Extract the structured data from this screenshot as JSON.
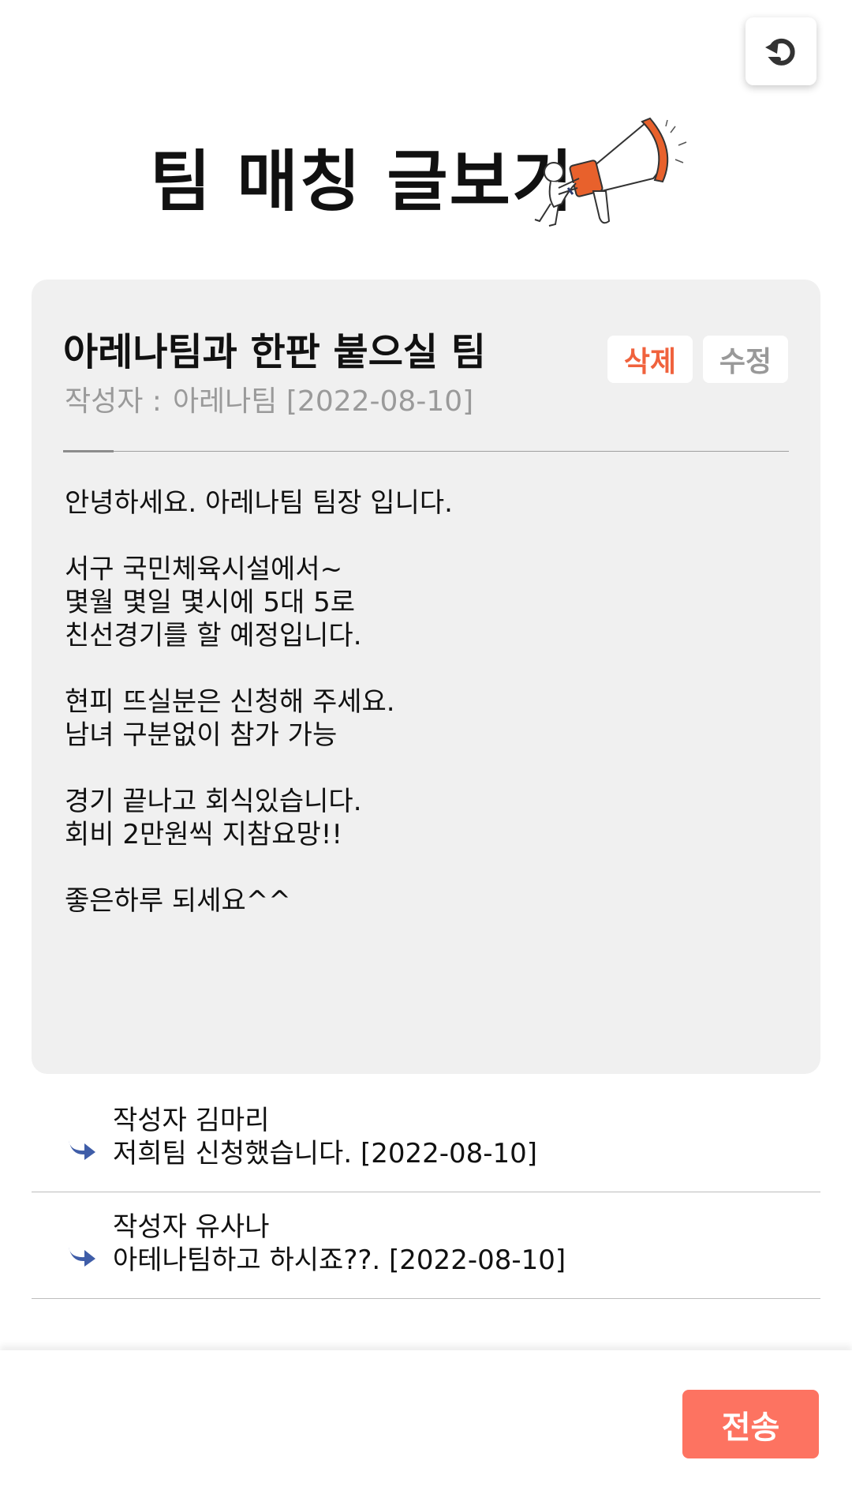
{
  "header": {
    "title": "팀 매칭 글보기",
    "back_icon": "undo-arrow-icon",
    "illustration": "megaphone-icon"
  },
  "post": {
    "title": "아레나팀과 한판 붙으실 팀",
    "author_label": "작성자 :",
    "author_name": "아레나팀",
    "date": "[2022-08-10]",
    "delete_label": "삭제",
    "edit_label": "수정",
    "body_lines": [
      "안녕하세요. 아레나팀 팀장 입니다.",
      "",
      "서구 국민체육시설에서~",
      "몇월 몇일 몇시에 5대 5로",
      "친선경기를 할 예정입니다.",
      "",
      "현피 뜨실분은 신청해 주세요.",
      "남녀 구분없이 참가 가능",
      "",
      "경기 끝나고 회식있습니다.",
      "회비 2만원씩 지참요망!!",
      "",
      "좋은하루 되세요^^"
    ]
  },
  "comments": [
    {
      "author": "작성자 김마리",
      "text": "저희팀 신청했습니다. [2022-08-10]"
    },
    {
      "author": "작성자 유사나",
      "text": "아테나팀하고 하시죠??. [2022-08-10]"
    }
  ],
  "footer": {
    "send_label": "전송"
  },
  "colors": {
    "accent": "#fd7361",
    "delete_text": "#f0623d",
    "reply_icon": "#3f5da8",
    "card_bg": "#f0f0f0"
  }
}
